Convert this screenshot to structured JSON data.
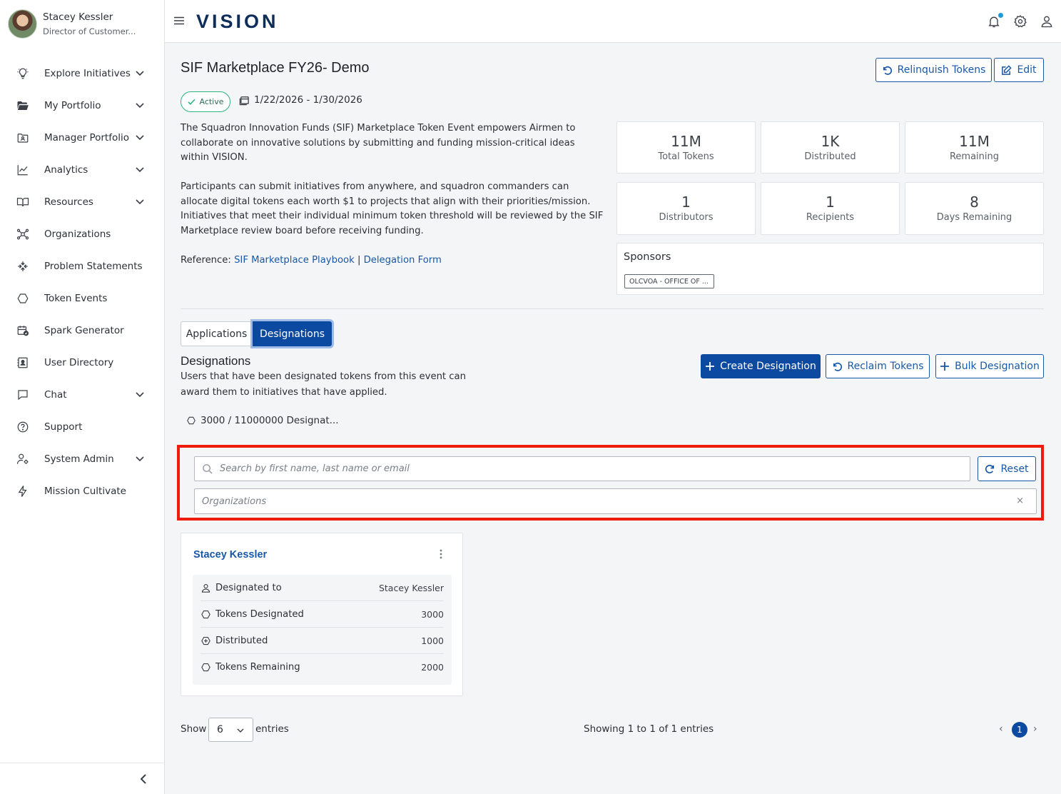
{
  "user": {
    "name": "Stacey Kessler",
    "role": "Director of Customer..."
  },
  "sidebar": {
    "items": [
      {
        "label": "Explore Initiatives",
        "icon": "lightbulb-icon",
        "has_chevron": true
      },
      {
        "label": "My Portfolio",
        "icon": "folder-open-icon",
        "has_chevron": true
      },
      {
        "label": "Manager Portfolio",
        "icon": "folder-user-icon",
        "has_chevron": true
      },
      {
        "label": "Analytics",
        "icon": "chart-line-icon",
        "has_chevron": true
      },
      {
        "label": "Resources",
        "icon": "book-open-icon",
        "has_chevron": true
      },
      {
        "label": "Organizations",
        "icon": "network-icon",
        "has_chevron": false
      },
      {
        "label": "Problem Statements",
        "icon": "arrows-converge-icon",
        "has_chevron": false
      },
      {
        "label": "Token Events",
        "icon": "hexagon-icon",
        "has_chevron": false
      },
      {
        "label": "Spark Generator",
        "icon": "calendar-check-icon",
        "has_chevron": false
      },
      {
        "label": "User Directory",
        "icon": "contact-card-icon",
        "has_chevron": false
      },
      {
        "label": "Chat",
        "icon": "chat-bubble-icon",
        "has_chevron": true
      },
      {
        "label": "Support",
        "icon": "help-circle-icon",
        "has_chevron": false
      },
      {
        "label": "System Admin",
        "icon": "user-gear-icon",
        "has_chevron": true
      },
      {
        "label": "Mission Cultivate",
        "icon": "lightning-icon",
        "has_chevron": false
      }
    ]
  },
  "topbar": {
    "logo": "VISION",
    "notification_dot_color": "#1d9bd7"
  },
  "event": {
    "title": "SIF Marketplace FY26- Demo",
    "status": "Active",
    "date_range": "1/22/2026 - 1/30/2026",
    "description": [
      "The Squadron Innovation Funds (SIF) Marketplace Token Event empowers Airmen to collaborate on innovative solutions by submitting and funding mission-critical ideas within VISION.",
      "Participants can submit initiatives from anywhere, and squadron commanders can allocate digital tokens each worth $1 to projects that align with their priorities/mission. Initiatives that meet their individual minimum token threshold will be reviewed by the SIF Marketplace review board before receiving funding."
    ],
    "reference_label": "Reference:",
    "reference_link_1": "SIF Marketplace Playbook",
    "reference_separator": "|",
    "reference_link_2": "Delegation Form",
    "relinquish_label": "Relinquish Tokens",
    "edit_label": "Edit"
  },
  "stats": [
    {
      "value": "11M",
      "label": "Total Tokens"
    },
    {
      "value": "1K",
      "label": "Distributed"
    },
    {
      "value": "11M",
      "label": "Remaining"
    },
    {
      "value": "1",
      "label": "Distributors"
    },
    {
      "value": "1",
      "label": "Recipients"
    },
    {
      "value": "8",
      "label": "Days Remaining"
    }
  ],
  "sponsors": {
    "title": "Sponsors",
    "tags": [
      "OLCVOA - OFFICE OF ..."
    ]
  },
  "tabs": [
    {
      "label": "Applications",
      "active": false
    },
    {
      "label": "Designations",
      "active": true
    }
  ],
  "designations": {
    "title": "Designations",
    "description": "Users that have been designated tokens from this event can award them to initiatives that have applied.",
    "count_text": "3000 / 11000000 Designat...",
    "create_label": "Create Designation",
    "reclaim_label": "Reclaim Tokens",
    "bulk_label": "Bulk Designation",
    "search_placeholder": "Search by first name, last name or email",
    "reset_label": "Reset",
    "org_placeholder": "Organizations",
    "org_clear": "×"
  },
  "card": {
    "title": "Stacey Kessler",
    "rows": [
      {
        "label": "Designated to",
        "value": "Stacey Kessler",
        "icon": "user-icon",
        "is_link": true
      },
      {
        "label": "Tokens Designated",
        "value": "3000",
        "icon": "hexagon-icon",
        "is_link": false
      },
      {
        "label": "Distributed",
        "value": "1000",
        "icon": "hexagon-plus-icon",
        "is_link": false
      },
      {
        "label": "Tokens Remaining",
        "value": "2000",
        "icon": "hexagon-icon",
        "is_link": false
      }
    ]
  },
  "pagination": {
    "show_label": "Show",
    "page_size": "6",
    "entries_label": "entries",
    "showing_text": "Showing 1 to 1 of 1 entries",
    "prev": "‹",
    "current_page": "1",
    "next": "›"
  },
  "colors": {
    "primary": "#0b4aa0",
    "link": "#1758a8",
    "active_green": "#2fb380",
    "highlight_red": "#ee1c08"
  }
}
